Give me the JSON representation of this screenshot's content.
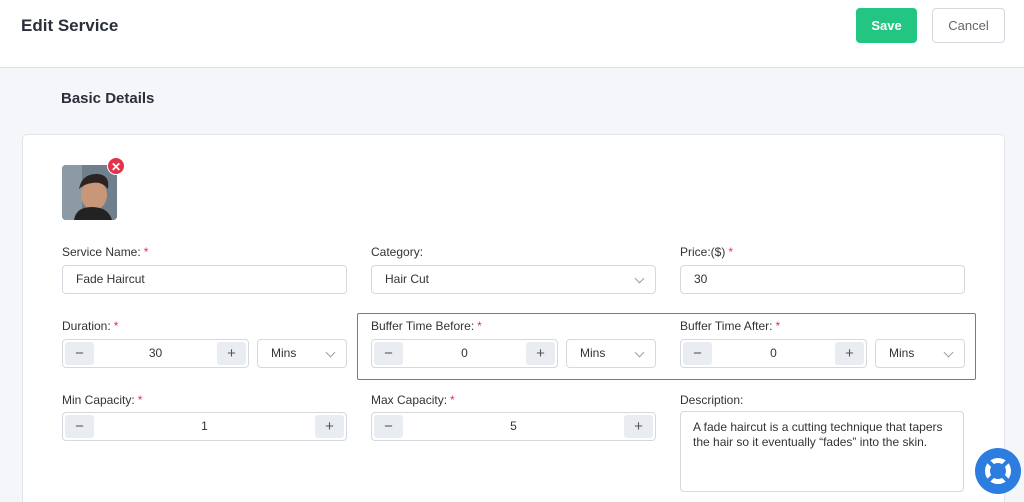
{
  "header": {
    "title": "Edit Service",
    "save_label": "Save",
    "cancel_label": "Cancel"
  },
  "section": {
    "title": "Basic Details"
  },
  "image": {
    "remove_symbol": "✕"
  },
  "fields": {
    "service_name": {
      "label": "Service Name:",
      "required": "*",
      "value": "Fade Haircut"
    },
    "category": {
      "label": "Category:",
      "value": "Hair Cut"
    },
    "price": {
      "label": "Price:($)",
      "required": "*",
      "value": "30"
    },
    "duration": {
      "label": "Duration:",
      "required": "*",
      "value": "30",
      "unit": "Mins"
    },
    "buffer_before": {
      "label": "Buffer Time Before:",
      "required": "*",
      "value": "0",
      "unit": "Mins"
    },
    "buffer_after": {
      "label": "Buffer Time After:",
      "required": "*",
      "value": "0",
      "unit": "Mins"
    },
    "min_capacity": {
      "label": "Min Capacity:",
      "required": "*",
      "value": "1"
    },
    "max_capacity": {
      "label": "Max Capacity:",
      "required": "*",
      "value": "5"
    },
    "description": {
      "label": "Description:",
      "value": "A fade haircut is a cutting technique that tapers the hair so it eventually “fades” into the skin."
    }
  },
  "stepper": {
    "minus": "−",
    "plus": "+"
  },
  "colors": {
    "accent": "#22c582",
    "required": "#e2334a",
    "highlight": "#d9534f",
    "help": "#2d7de0"
  },
  "icons": {
    "help": "lifebuoy-icon",
    "remove": "close-icon",
    "dropdown": "chevron-down-icon"
  }
}
